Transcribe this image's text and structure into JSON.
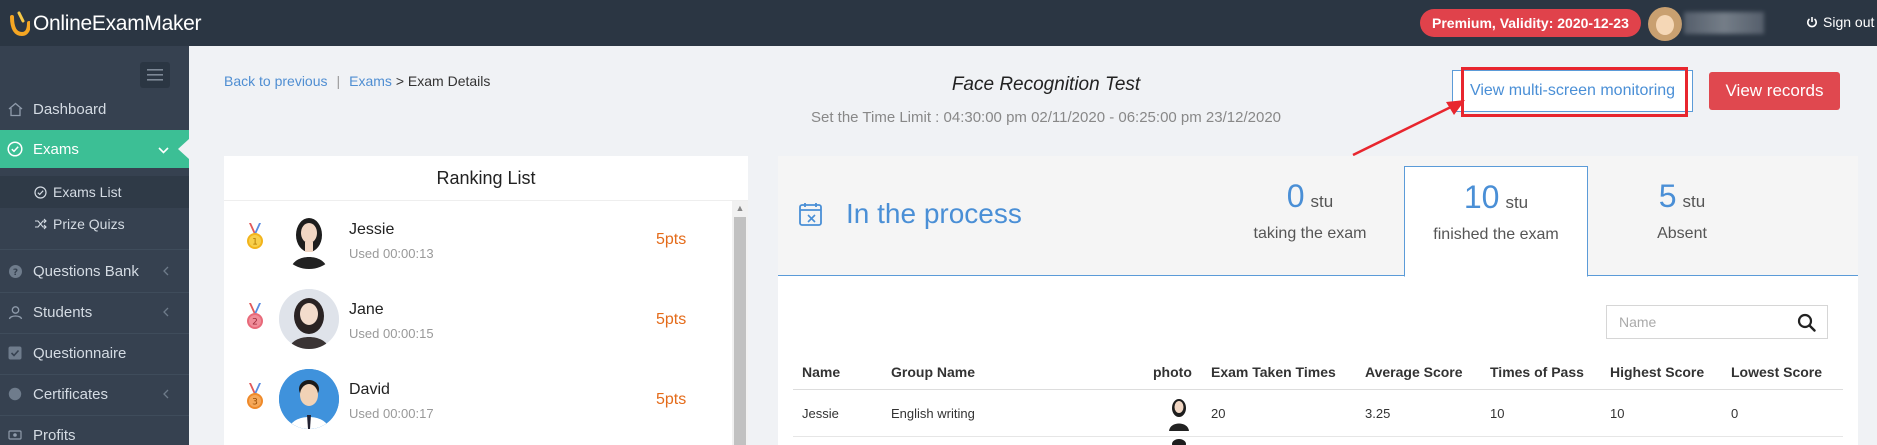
{
  "topbar": {
    "logo_text": "OnlineExamMaker",
    "premium_label": "Premium, Validity: 2020-12-23",
    "signout_label": "Sign out"
  },
  "sidebar": {
    "items": [
      {
        "label": "Dashboard",
        "icon": "home-icon"
      },
      {
        "label": "Exams",
        "icon": "check-circle-icon",
        "active": true
      },
      {
        "label": "Questions Bank",
        "icon": "question-icon"
      },
      {
        "label": "Students",
        "icon": "user-icon"
      },
      {
        "label": "Questionnaire",
        "icon": "checkbox-icon"
      },
      {
        "label": "Certificates",
        "icon": "certificate-icon"
      },
      {
        "label": "Profits",
        "icon": "money-icon"
      }
    ],
    "sub_items": [
      {
        "label": "Exams List",
        "icon": "check-circle-icon"
      },
      {
        "label": "Prize Quizs",
        "icon": "shuffle-icon"
      }
    ]
  },
  "breadcrumb": {
    "back": "Back to previous",
    "separator": "|",
    "exams": "Exams",
    "arrow": ">",
    "current": "Exam Details"
  },
  "exam": {
    "title": "Face Recognition Test",
    "time_limit": "Set the Time Limit : 04:30:00 pm 02/11/2020 - 06:25:00 pm 23/12/2020"
  },
  "buttons": {
    "multi_screen": "View multi-screen monitoring",
    "records": "View records"
  },
  "ranking": {
    "title": "Ranking List",
    "entries": [
      {
        "rank": "1",
        "name": "Jessie",
        "used": "Used  00:00:13",
        "pts": "5pts",
        "medal_color": "#f2b41c"
      },
      {
        "rank": "2",
        "name": "Jane",
        "used": "Used  00:00:15",
        "pts": "5pts",
        "medal_color": "#e86a7a"
      },
      {
        "rank": "3",
        "name": "David",
        "used": "Used  00:00:17",
        "pts": "5pts",
        "medal_color": "#ef8a2a"
      }
    ]
  },
  "stats": {
    "status": "In the process",
    "unit": "stu",
    "boxes": [
      {
        "num": "0",
        "label": "taking the exam"
      },
      {
        "num": "10",
        "label": "finished the exam",
        "active": true
      },
      {
        "num": "5",
        "label": "Absent"
      }
    ]
  },
  "search": {
    "placeholder": "Name"
  },
  "table": {
    "columns": [
      "Name",
      "Group Name",
      "photo",
      "Exam Taken Times",
      "Average Score",
      "Times of Pass",
      "Highest Score",
      "Lowest Score"
    ],
    "rows": [
      {
        "name": "Jessie",
        "group": "English writing",
        "times": "20",
        "avg": "3.25",
        "pass": "10",
        "high": "10",
        "low": "0"
      }
    ]
  },
  "colors": {
    "topbar": "#2b3643",
    "sidebar": "#364150",
    "active": "#3cbf95",
    "primary": "#4a8fd6",
    "danger": "#e0484f",
    "points": "#e46b1a"
  }
}
